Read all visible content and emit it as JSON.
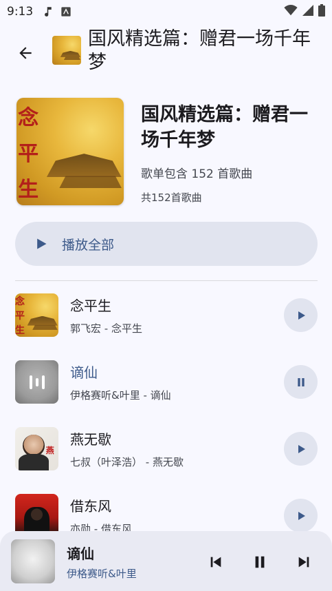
{
  "status_bar": {
    "time": "9:13"
  },
  "header": {
    "title": "国风精选篇：赠君一场千年梦"
  },
  "playlist": {
    "title": "国风精选篇：赠君一场千年梦",
    "description": "歌单包含 152 首歌曲",
    "count_text": "共152首歌曲",
    "play_all_label": "播放全部"
  },
  "songs": [
    {
      "title": "念平生",
      "subtitle": "郭飞宏 - 念平生",
      "state": "paused"
    },
    {
      "title": "谪仙",
      "subtitle": "伊格赛听&叶里 - 谪仙",
      "state": "playing"
    },
    {
      "title": "燕无歇",
      "subtitle": "七叔（叶泽浩） - 燕无歇",
      "state": "paused"
    },
    {
      "title": "借东风",
      "subtitle": "亦勋 - 借东风",
      "state": "paused"
    }
  ],
  "mini_player": {
    "title": "谪仙",
    "artist": "伊格赛听&叶里"
  },
  "cover_art_text": {
    "hero": [
      "念",
      "平",
      "生"
    ],
    "portrait_tag": "燕"
  },
  "colors": {
    "accent": "#3d5a8a",
    "button_bg": "#e1e4ef",
    "background": "#f8f8ff"
  }
}
